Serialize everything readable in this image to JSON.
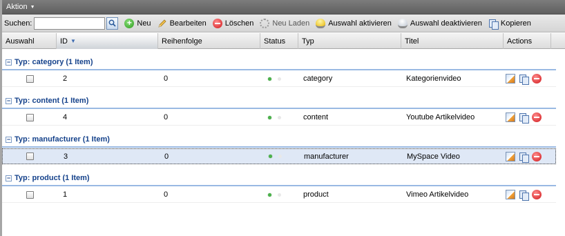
{
  "menubar": {
    "aktion_label": "Aktion"
  },
  "toolbar": {
    "search_label": "Suchen:",
    "search_value": "",
    "buttons": {
      "neu": "Neu",
      "bearbeiten": "Bearbeiten",
      "loeschen": "Löschen",
      "neu_laden": "Neu Laden",
      "auswahl_aktivieren": "Auswahl aktivieren",
      "auswahl_deaktivieren": "Auswahl deaktivieren",
      "kopieren": "Kopieren"
    }
  },
  "grid": {
    "columns": {
      "auswahl": "Auswahl",
      "id": "ID",
      "reihenfolge": "Reihenfolge",
      "status": "Status",
      "typ": "Typ",
      "titel": "Titel",
      "actions": "Actions"
    },
    "groups": [
      {
        "label": "Typ: category (1 Item)",
        "row": {
          "id": "2",
          "reihenfolge": "0",
          "typ": "category",
          "titel": "Kategorienvideo",
          "selected": false
        }
      },
      {
        "label": "Typ: content (1 Item)",
        "row": {
          "id": "4",
          "reihenfolge": "0",
          "typ": "content",
          "titel": "Youtube Artikelvideo",
          "selected": false
        }
      },
      {
        "label": "Typ: manufacturer (1 Item)",
        "row": {
          "id": "3",
          "reihenfolge": "0",
          "typ": "manufacturer",
          "titel": "MySpace Video",
          "selected": true
        }
      },
      {
        "label": "Typ: product (1 Item)",
        "row": {
          "id": "1",
          "reihenfolge": "0",
          "typ": "product",
          "titel": "Vimeo Artikelvideo",
          "selected": false
        }
      }
    ]
  },
  "colors": {
    "group_text": "#15428b",
    "group_line": "#99b9e3",
    "selected_row": "#dfe8f6",
    "status_active": "#4bb24b"
  }
}
